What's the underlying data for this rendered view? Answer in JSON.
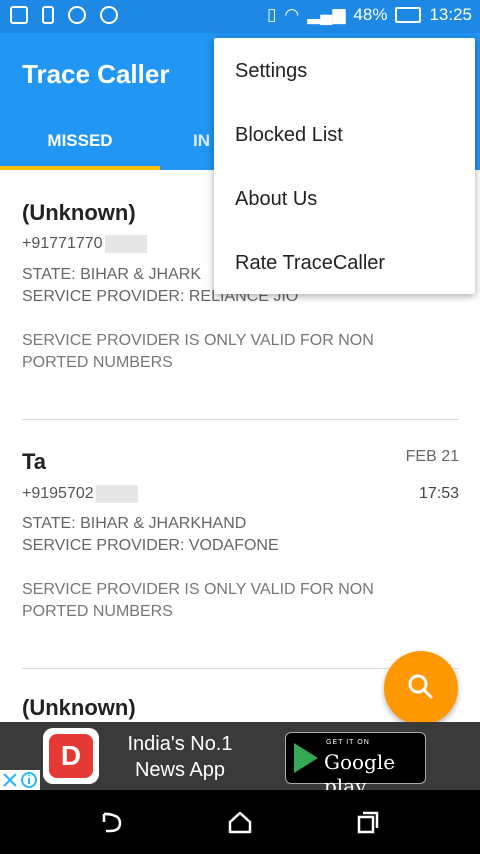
{
  "status_bar": {
    "battery": "48%",
    "time": "13:25",
    "icons": [
      "dual-sim-icon",
      "sd-card-icon",
      "messenger-icon",
      "sync-icon",
      "vibrate-icon",
      "wifi-icon",
      "signal-icon",
      "battery-icon"
    ]
  },
  "app_bar": {
    "title": "Trace Caller"
  },
  "tabs": [
    {
      "label": "MISSED",
      "selected": true
    },
    {
      "label": "IN",
      "selected": false
    }
  ],
  "entries": [
    {
      "name": "(Unknown)",
      "number": "+91771770",
      "state": "STATE: BIHAR & JHARK",
      "provider": "SERVICE PROVIDER: RELIANCE JIO",
      "note_line1": "SERVICE PROVIDER IS ONLY VALID FOR NON",
      "note_line2": "PORTED NUMBERS"
    },
    {
      "name": "Ta",
      "number": "+9195702",
      "date": "FEB 21",
      "time": "17:53",
      "state": "STATE: BIHAR & JHARKHAND",
      "provider": "SERVICE PROVIDER: VODAFONE",
      "note_line1": "SERVICE PROVIDER IS ONLY VALID FOR NON",
      "note_line2": "PORTED NUMBERS"
    },
    {
      "name": "(Unknown)"
    }
  ],
  "menu": {
    "items": [
      "Settings",
      "Blocked List",
      "About Us",
      "Rate TraceCaller"
    ]
  },
  "fab": {
    "icon": "search-icon"
  },
  "ad": {
    "text_line1": "India's No.1",
    "text_line2": "News App",
    "store_small": "GET IT ON",
    "store_big": "Google play"
  },
  "colors": {
    "primary": "#2196f3",
    "status_bar": "#1e88e5",
    "accent": "#ffc107",
    "fab": "#ff9800"
  }
}
